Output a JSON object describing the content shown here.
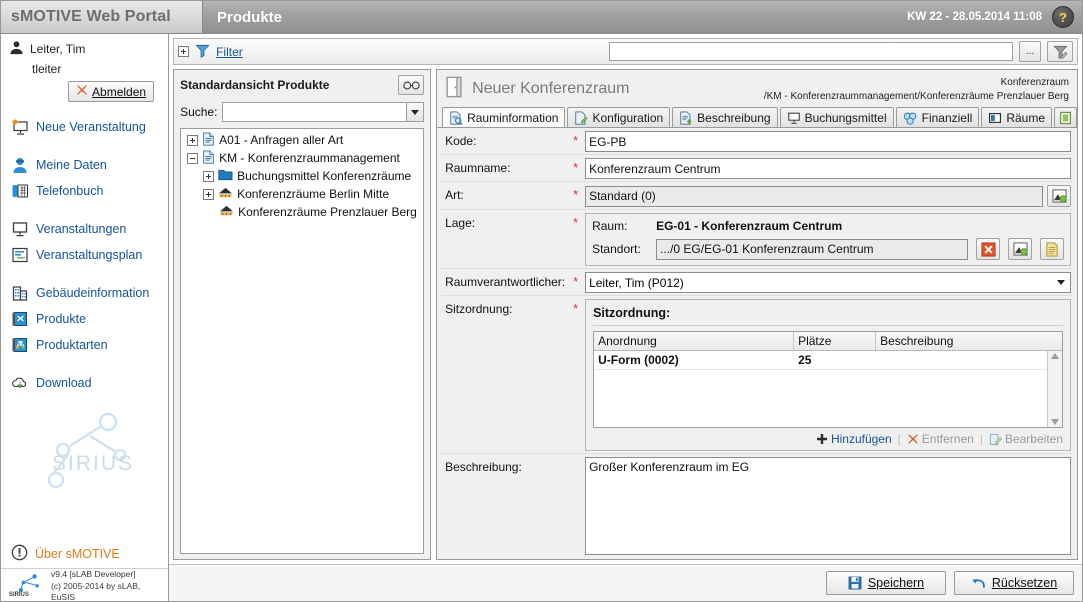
{
  "header": {
    "brand": "sMOTIVE Web Portal",
    "title": "Produkte",
    "datetime": "KW 22 - 28.05.2014 11:08",
    "help_icon": "question-mark-icon"
  },
  "sidebar": {
    "user_name": "Leiter, Tim",
    "user_login": "tleiter",
    "logout_label": "Abmelden",
    "nav_groups": [
      {
        "items": [
          {
            "label": "Neue Veranstaltung",
            "icon": "new-presentation-icon"
          }
        ]
      },
      {
        "items": [
          {
            "label": "Meine Daten",
            "icon": "user-icon"
          },
          {
            "label": "Telefonbuch",
            "icon": "phonebook-icon"
          }
        ]
      },
      {
        "items": [
          {
            "label": "Veranstaltungen",
            "icon": "presentation-icon"
          },
          {
            "label": "Veranstaltungsplan",
            "icon": "schedule-icon"
          }
        ]
      },
      {
        "items": [
          {
            "label": "Gebäudeinformation",
            "icon": "building-icon"
          },
          {
            "label": "Produkte",
            "icon": "product-book-icon"
          },
          {
            "label": "Produktarten",
            "icon": "product-types-icon"
          }
        ]
      },
      {
        "items": [
          {
            "label": "Download",
            "icon": "download-cloud-icon"
          }
        ]
      }
    ],
    "about_label": "Über sMOTIVE",
    "about_icon": "info-icon",
    "watermark": "SIRIUS",
    "footer_line1": "v9.4 [sLAB Developer]",
    "footer_line2": "(c) 2005-2014 by sLAB, EuSIS"
  },
  "filter_bar": {
    "label": "Filter",
    "expander_icon": "plus-box-icon",
    "funnel_icon": "filter-funnel-icon",
    "input_value": "",
    "ellipsis_button": "...",
    "apply_icon": "filter-edit-icon"
  },
  "tree_panel": {
    "title": "Standardansicht Produkte",
    "glasses_icon": "glasses-icon",
    "search_label": "Suche:",
    "search_value": "",
    "nodes": [
      {
        "label": "A01 - Anfragen aller Art",
        "level": 0,
        "toggle": "plus",
        "icon": "document-icon"
      },
      {
        "label": "KM - Konferenzraummanagement",
        "level": 0,
        "toggle": "minus",
        "icon": "document-icon"
      },
      {
        "label": "Buchungsmittel Konferenzräume",
        "level": 1,
        "toggle": "plus",
        "icon": "folder-icon"
      },
      {
        "label": "Konferenzräume Berlin Mitte",
        "level": 1,
        "toggle": "plus",
        "icon": "house-icon"
      },
      {
        "label": "Konferenzräume Prenzlauer Berg",
        "level": 1,
        "toggle": "none",
        "icon": "house-icon"
      }
    ]
  },
  "detail": {
    "title": "Neuer Konferenzraum",
    "title_icon": "door-icon",
    "path_line1": "Konferenzraum",
    "path_line2": "/KM - Konferenzraummanagement/Konferenzräume Prenzlauer Berg",
    "tabs": [
      {
        "label": "Rauminformation",
        "icon": "room-info-icon",
        "active": true
      },
      {
        "label": "Konfiguration",
        "icon": "config-icon",
        "active": false
      },
      {
        "label": "Beschreibung",
        "icon": "description-icon",
        "active": false
      },
      {
        "label": "Buchungsmittel",
        "icon": "booking-icon",
        "active": false
      },
      {
        "label": "Finanziell",
        "icon": "finance-icon",
        "active": false
      },
      {
        "label": "Räume",
        "icon": "rooms-icon",
        "active": false
      },
      {
        "label": "",
        "icon": "more-tab-icon",
        "active": false
      }
    ],
    "fields": {
      "kode_label": "Kode:",
      "kode_value": "EG-PB",
      "raumname_label": "Raumname:",
      "raumname_value": "Konferenzraum Centrum",
      "art_label": "Art:",
      "art_value": "Standard (0)",
      "art_picker_icon": "picker-icon",
      "lage_label": "Lage:",
      "raum_label": "Raum:",
      "raum_value": "EG-01 - Konferenzraum Centrum",
      "standort_label": "Standort:",
      "standort_value": ".../0 EG/EG-01 Konferenzraum Centrum",
      "standort_clear_icon": "delete-red-x-icon",
      "standort_picker_icon": "picker-icon",
      "standort_doc_icon": "document-yellow-icon",
      "verantwortlicher_label": "Raumverantwortlicher:",
      "verantwortlicher_value": "Leiter, Tim (P012)",
      "sitzordnung_label": "Sitzordnung:",
      "beschreibung_label": "Beschreibung:",
      "beschreibung_value": "Großer Konferenzraum im EG"
    },
    "sitzordnung": {
      "group_title": "Sitzordnung:",
      "columns": [
        "Anordnung",
        "Plätze",
        "Beschreibung"
      ],
      "rows": [
        {
          "anordnung": "U-Form (0002)",
          "plaetze": "25",
          "beschreibung": ""
        }
      ],
      "actions": [
        {
          "label": "Hinzufügen",
          "icon": "plus-icon",
          "enabled": true
        },
        {
          "label": "Entfernen",
          "icon": "red-x-icon",
          "enabled": false
        },
        {
          "label": "Bearbeiten",
          "icon": "edit-icon",
          "enabled": false
        }
      ]
    }
  },
  "footer": {
    "save_label": "Speichern",
    "save_icon": "save-disk-icon",
    "reset_label": "Rücksetzen",
    "reset_icon": "undo-arrow-icon"
  },
  "colors": {
    "link": "#14549b",
    "accent_orange": "#e07b18",
    "required_red": "#e03030",
    "header_gray": "#9e9e9e"
  }
}
